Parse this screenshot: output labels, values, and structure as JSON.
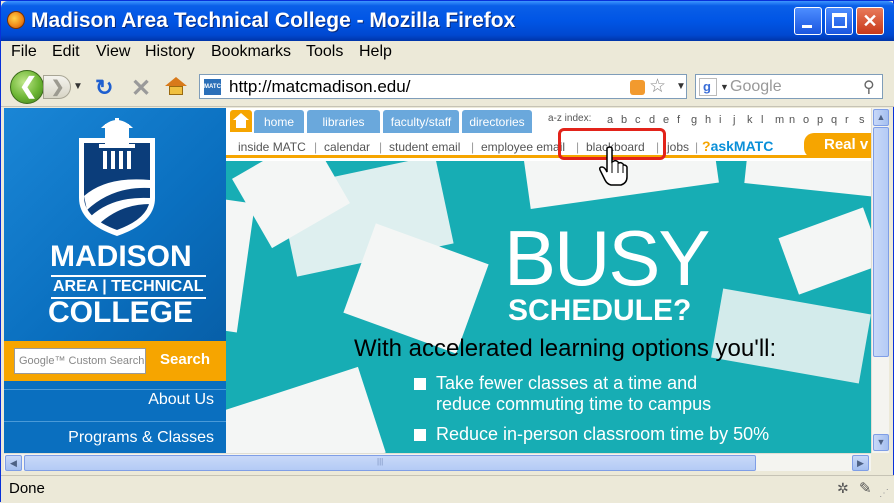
{
  "window": {
    "title": "Madison Area Technical College - Mozilla Firefox"
  },
  "menu": {
    "items": [
      "File",
      "Edit",
      "View",
      "History",
      "Bookmarks",
      "Tools",
      "Help"
    ]
  },
  "toolbar": {
    "url": "http://matcmadison.edu/",
    "favicon_text": "MATC",
    "search_placeholder": "Google"
  },
  "site": {
    "logo_line1": "MADISON",
    "logo_line2": "AREA | TECHNICAL",
    "logo_line3": "COLLEGE",
    "custom_search_placeholder": "Google™ Custom Search",
    "search_button": "Search",
    "side_links": [
      "About Us",
      "Programs & Classes"
    ],
    "top_tabs": [
      "home",
      "libraries",
      "faculty/staff",
      "directories"
    ],
    "az_label": "a-z index:",
    "az_letters": [
      "a",
      "b",
      "c",
      "d",
      "e",
      "f",
      "g",
      "h",
      "i",
      "j",
      "k",
      "l",
      "m",
      "n",
      "o",
      "p",
      "q",
      "r",
      "s"
    ],
    "sub_links": [
      "inside MATC",
      "calendar",
      "student email",
      "employee email",
      "blackboard",
      "jobs"
    ],
    "ask_prefix": "?",
    "ask_label": "askMATC",
    "real_label": "Real v",
    "hero": {
      "headline": "BUSY",
      "subheadline": "SCHEDULE?",
      "lead": "With accelerated learning options you'll:",
      "bullets": [
        "Take fewer classes at a time and\nreduce commuting time to campus",
        "Reduce in-person classroom time by 50%"
      ]
    }
  },
  "status": {
    "text": "Done"
  },
  "colors": {
    "accent": "#f6a500",
    "brand": "#0a6fbf",
    "hero": "#17adb4",
    "highlight": "#e2231a"
  }
}
